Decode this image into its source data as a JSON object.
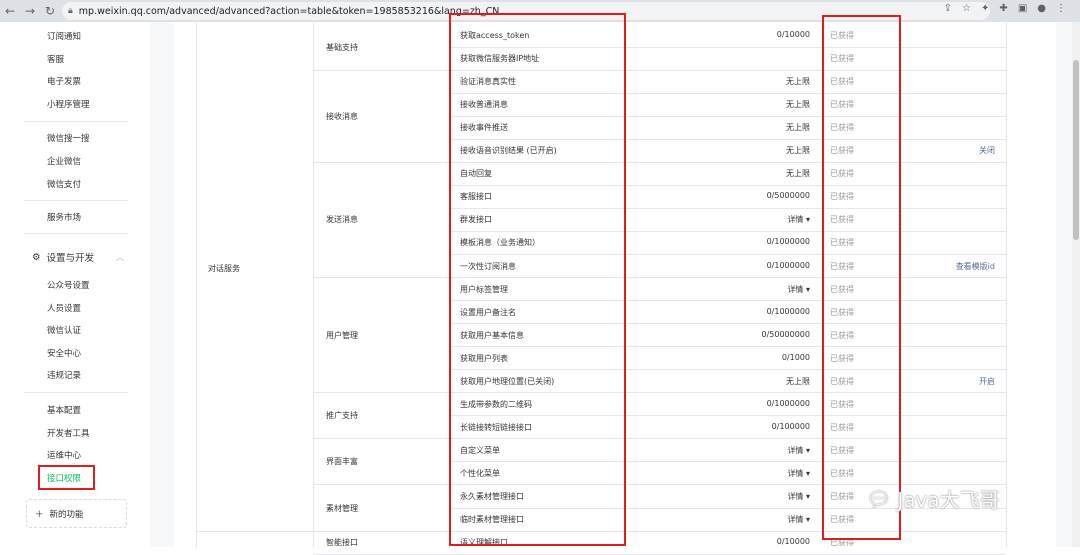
{
  "browser": {
    "url": "mp.weixin.qq.com/advanced/advanced?action=table&token=1985853216&lang=zh_CN"
  },
  "sidebar": {
    "items_top": [
      "订阅通知",
      "客服",
      "电子发票",
      "小程序管理"
    ],
    "items_mid": [
      "微信搜一搜",
      "企业微信",
      "微信支付"
    ],
    "market": "服务市场",
    "settings_section": "设置与开发",
    "settings_items": [
      "公众号设置",
      "人员设置",
      "微信认证",
      "安全中心",
      "违规记录"
    ],
    "dev_items": [
      "基本配置",
      "开发者工具",
      "运维中心",
      "接口权限"
    ],
    "new_func": "新的功能"
  },
  "table": {
    "top_category": "对话服务",
    "groups": [
      {
        "name": "基础支持"
      },
      {
        "name": "接收消息"
      },
      {
        "name": "发送消息"
      },
      {
        "name": "用户管理"
      },
      {
        "name": "推广支持"
      },
      {
        "name": "界面丰富"
      },
      {
        "name": "素材管理"
      },
      {
        "name": "智能接口"
      }
    ],
    "rows": [
      {
        "name": "获取access_token",
        "quota": "0/10000",
        "status": "已获得",
        "op": ""
      },
      {
        "name": "获取微信服务器IP地址",
        "quota": "",
        "status": "已获得",
        "op": ""
      },
      {
        "name": "验证消息真实性",
        "quota": "无上限",
        "status": "已获得",
        "op": ""
      },
      {
        "name": "接收普通消息",
        "quota": "无上限",
        "status": "已获得",
        "op": ""
      },
      {
        "name": "接收事件推送",
        "quota": "无上限",
        "status": "已获得",
        "op": ""
      },
      {
        "name": "接收语音识别结果 (已开启)",
        "quota": "无上限",
        "status": "已获得",
        "op": "关闭"
      },
      {
        "name": "自动回复",
        "quota": "无上限",
        "status": "已获得",
        "op": ""
      },
      {
        "name": "客服接口",
        "quota": "0/5000000",
        "status": "已获得",
        "op": ""
      },
      {
        "name": "群发接口",
        "quota": "详情 ▾",
        "status": "已获得",
        "op": ""
      },
      {
        "name": "模板消息（业务通知）",
        "quota": "0/1000000",
        "status": "已获得",
        "op": ""
      },
      {
        "name": "一次性订阅消息",
        "quota": "0/1000000",
        "status": "已获得",
        "op": "查看模版id"
      },
      {
        "name": "用户标签管理",
        "quota": "详情 ▾",
        "status": "已获得",
        "op": ""
      },
      {
        "name": "设置用户备注名",
        "quota": "0/1000000",
        "status": "已获得",
        "op": ""
      },
      {
        "name": "获取用户基本信息",
        "quota": "0/50000000",
        "status": "已获得",
        "op": ""
      },
      {
        "name": "获取用户列表",
        "quota": "0/1000",
        "status": "已获得",
        "op": ""
      },
      {
        "name": "获取用户地理位置(已关闭)",
        "quota": "无上限",
        "status": "已获得",
        "op": "开启"
      },
      {
        "name": "生成带参数的二维码",
        "quota": "0/1000000",
        "status": "已获得",
        "op": ""
      },
      {
        "name": "长链接转短链接接口",
        "quota": "0/100000",
        "status": "已获得",
        "op": ""
      },
      {
        "name": "自定义菜单",
        "quota": "详情 ▾",
        "status": "已获得",
        "op": ""
      },
      {
        "name": "个性化菜单",
        "quota": "详情 ▾",
        "status": "已获得",
        "op": ""
      },
      {
        "name": "永久素材管理接口",
        "quota": "详情 ▾",
        "status": "已获得",
        "op": ""
      },
      {
        "name": "临时素材管理接口",
        "quota": "详情 ▾",
        "status": "已获得",
        "op": ""
      },
      {
        "name": "语义理解接口",
        "quota": "0/10000",
        "status": "已获得",
        "op": ""
      }
    ]
  },
  "watermark": "Java大飞哥",
  "colors": {
    "accent": "#07c160",
    "link": "#576b95",
    "annotation": "#e01c1c"
  }
}
